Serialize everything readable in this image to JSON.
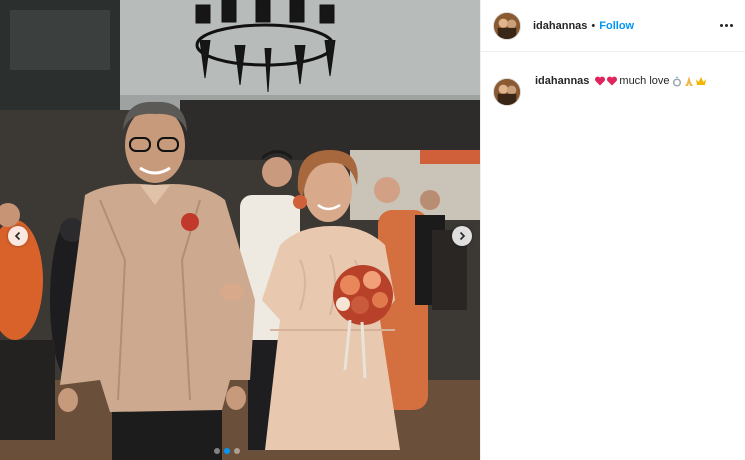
{
  "post": {
    "username": "idahannas",
    "separator": "•",
    "follow_label": "Follow",
    "more_icon": "more-horizontal-icon"
  },
  "caption": {
    "username": "idahannas",
    "text": "much love",
    "emojis_before": [
      "red-heart-emoji",
      "red-heart-emoji"
    ],
    "emojis_after": [
      "ring-emoji",
      "praying-hands-emoji",
      "crown-emoji"
    ]
  },
  "carousel": {
    "prev_icon": "chevron-left-icon",
    "next_icon": "chevron-right-icon",
    "slide_count": 3,
    "active_index": 1
  },
  "colors": {
    "accent": "#0095f6",
    "text": "#262626",
    "heart": "#ed4956",
    "divider": "#efefef"
  }
}
